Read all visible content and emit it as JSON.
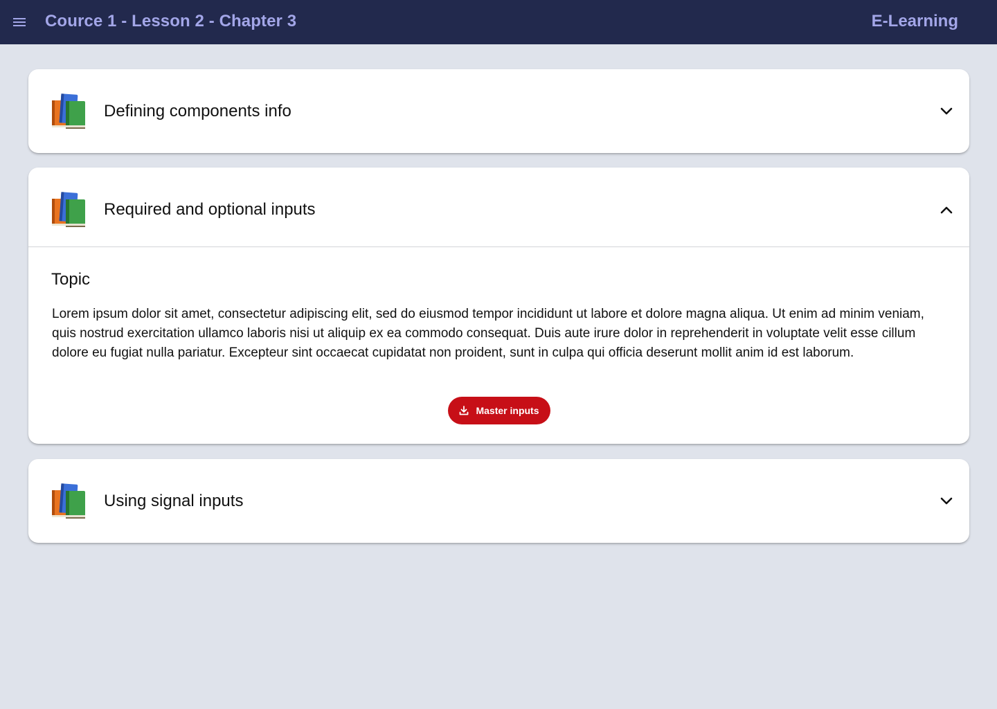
{
  "header": {
    "menu_icon": "menu-icon",
    "title": "Cource 1 - Lesson 2 - Chapter 3",
    "brand": "E-Learning",
    "background_color": "#22294d",
    "text_color": "#a3a6e8"
  },
  "panels": [
    {
      "icon": "books-icon",
      "title": "Defining components info",
      "state": "collapsed",
      "chevron": "chevron-down-icon"
    },
    {
      "icon": "books-icon",
      "title": "Required and optional inputs",
      "state": "expanded",
      "chevron": "chevron-up-icon",
      "body": {
        "heading": "Topic",
        "text": "Lorem ipsum dolor sit amet, consectetur adipiscing elit, sed do eiusmod tempor incididunt ut labore et dolore magna aliqua. Ut enim ad minim veniam, quis nostrud exercitation ullamco laboris nisi ut aliquip ex ea commodo consequat. Duis aute irure dolor in reprehenderit in voluptate velit esse cillum dolore eu fugiat nulla pariatur. Excepteur sint occaecat cupidatat non proident, sunt in culpa qui officia deserunt mollit anim id est laborum.",
        "button_label": "Master inputs",
        "button_icon": "download-icon",
        "button_color": "#c70f17"
      }
    },
    {
      "icon": "books-icon",
      "title": "Using signal inputs",
      "state": "collapsed",
      "chevron": "chevron-down-icon"
    }
  ],
  "page_background": "#dfe3eb"
}
